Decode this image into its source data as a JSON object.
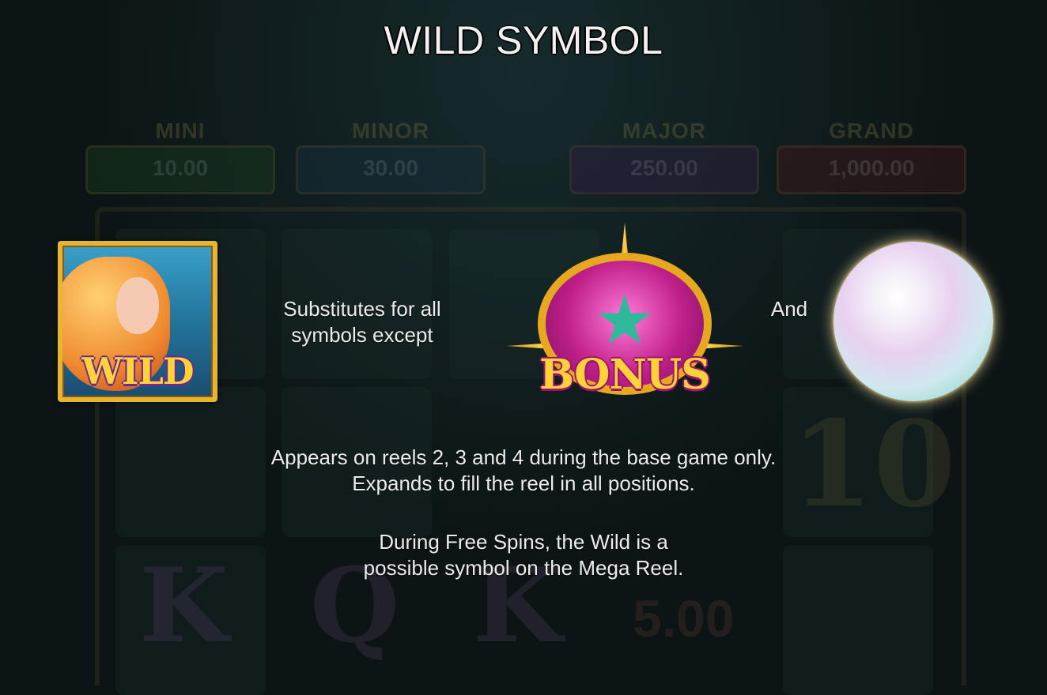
{
  "title": "WILD SYMBOL",
  "background": {
    "jackpots": [
      {
        "name": "MINI",
        "value": "10.00"
      },
      {
        "name": "MINOR",
        "value": "30.00"
      },
      {
        "name": "MAJOR",
        "value": "250.00"
      },
      {
        "name": "GRAND",
        "value": "1,000.00"
      }
    ],
    "reel_texts": [
      "10",
      "K",
      "Q",
      "K",
      "5.00"
    ]
  },
  "symbols": {
    "wild_label": "WILD",
    "bonus_label": "BONUS",
    "pearl_icon": "pearl-icon"
  },
  "text": {
    "substitutes_line1": "Substitutes for all",
    "substitutes_line2": "symbols except",
    "and": "And",
    "appears_line1": "Appears on reels 2, 3 and 4 during the base game only.",
    "appears_line2": "Expands to fill the reel in all positions.",
    "freespins_line1": "During Free Spins, the Wild is a",
    "freespins_line2": "possible symbol on the Mega Reel."
  },
  "colors": {
    "wild_gold": "#ffd23a",
    "bonus_magenta": "#c0208a",
    "text": "#ececec"
  }
}
